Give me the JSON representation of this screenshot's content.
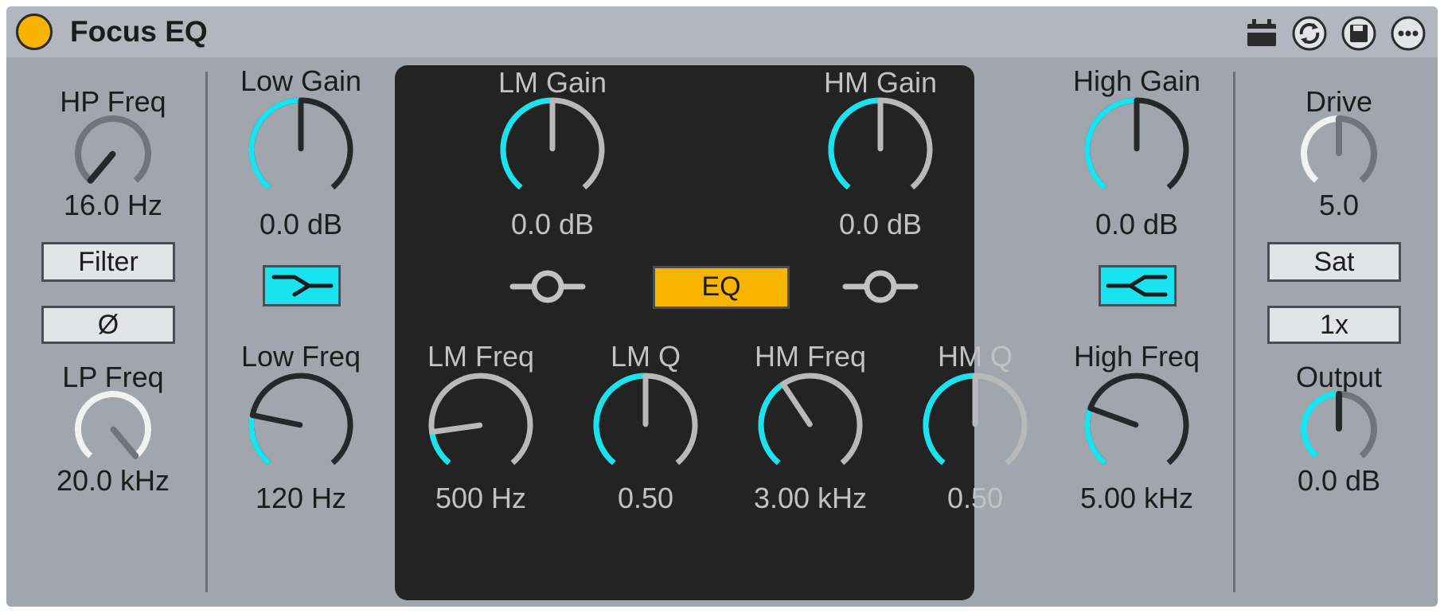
{
  "device": {
    "title": "Focus EQ"
  },
  "title_icons": [
    "midi-map-icon",
    "hot-swap-icon",
    "save-preset-icon",
    "more-options-icon"
  ],
  "colors": {
    "accent": "#19e3ef",
    "active": "#f8b500",
    "panel": "#a1a5ae",
    "display": "#232323"
  },
  "knobs": [
    {
      "id": "hp_freq",
      "label": "HP Freq",
      "value": "16.0 Hz",
      "fill": 0.0,
      "kind": "small",
      "theme": "light"
    },
    {
      "id": "lp_freq",
      "label": "LP Freq",
      "value": "20.0 kHz",
      "fill": 1.0,
      "kind": "small",
      "theme": "light"
    },
    {
      "id": "low_gain",
      "label": "Low Gain",
      "value": "0.0 dB",
      "fill": 0.5,
      "kind": "large",
      "theme": "light"
    },
    {
      "id": "low_freq",
      "label": "Low Freq",
      "value": "120 Hz",
      "fill": 0.22,
      "kind": "large",
      "theme": "light"
    },
    {
      "id": "lm_gain",
      "label": "LM Gain",
      "value": "0.0 dB",
      "fill": 0.5,
      "kind": "large",
      "theme": "dark"
    },
    {
      "id": "hm_gain",
      "label": "HM Gain",
      "value": "0.0 dB",
      "fill": 0.5,
      "kind": "large",
      "theme": "dark"
    },
    {
      "id": "lm_freq",
      "label": "LM Freq",
      "value": "500 Hz",
      "fill": 0.15,
      "kind": "large",
      "theme": "dark"
    },
    {
      "id": "lm_q",
      "label": "LM Q",
      "value": "0.50",
      "fill": 0.5,
      "kind": "large",
      "theme": "dark"
    },
    {
      "id": "hm_freq",
      "label": "HM Freq",
      "value": "3.00 kHz",
      "fill": 0.38,
      "kind": "large",
      "theme": "dark"
    },
    {
      "id": "hm_q",
      "label": "HM Q",
      "value": "0.50",
      "fill": 0.5,
      "kind": "large",
      "theme": "dark"
    },
    {
      "id": "high_gain",
      "label": "High Gain",
      "value": "0.0 dB",
      "fill": 0.5,
      "kind": "large",
      "theme": "light"
    },
    {
      "id": "high_freq",
      "label": "High Freq",
      "value": "5.00 kHz",
      "fill": 0.25,
      "kind": "large",
      "theme": "light"
    },
    {
      "id": "drive",
      "label": "Drive",
      "value": "5.0",
      "fill": 0.5,
      "kind": "small",
      "theme": "light-white"
    },
    {
      "id": "output",
      "label": "Output",
      "value": "0.0 dB",
      "fill": 0.5,
      "kind": "small",
      "theme": "light"
    }
  ],
  "buttons": {
    "filter": "Filter",
    "phase": "Ø",
    "eq": "EQ",
    "sat": "Sat",
    "oversample": "1x"
  },
  "shapes": {
    "low": "low-shelf-icon",
    "high": "high-shelf-icon",
    "lm": "lm-bell-icon",
    "hm": "hm-bell-icon"
  }
}
